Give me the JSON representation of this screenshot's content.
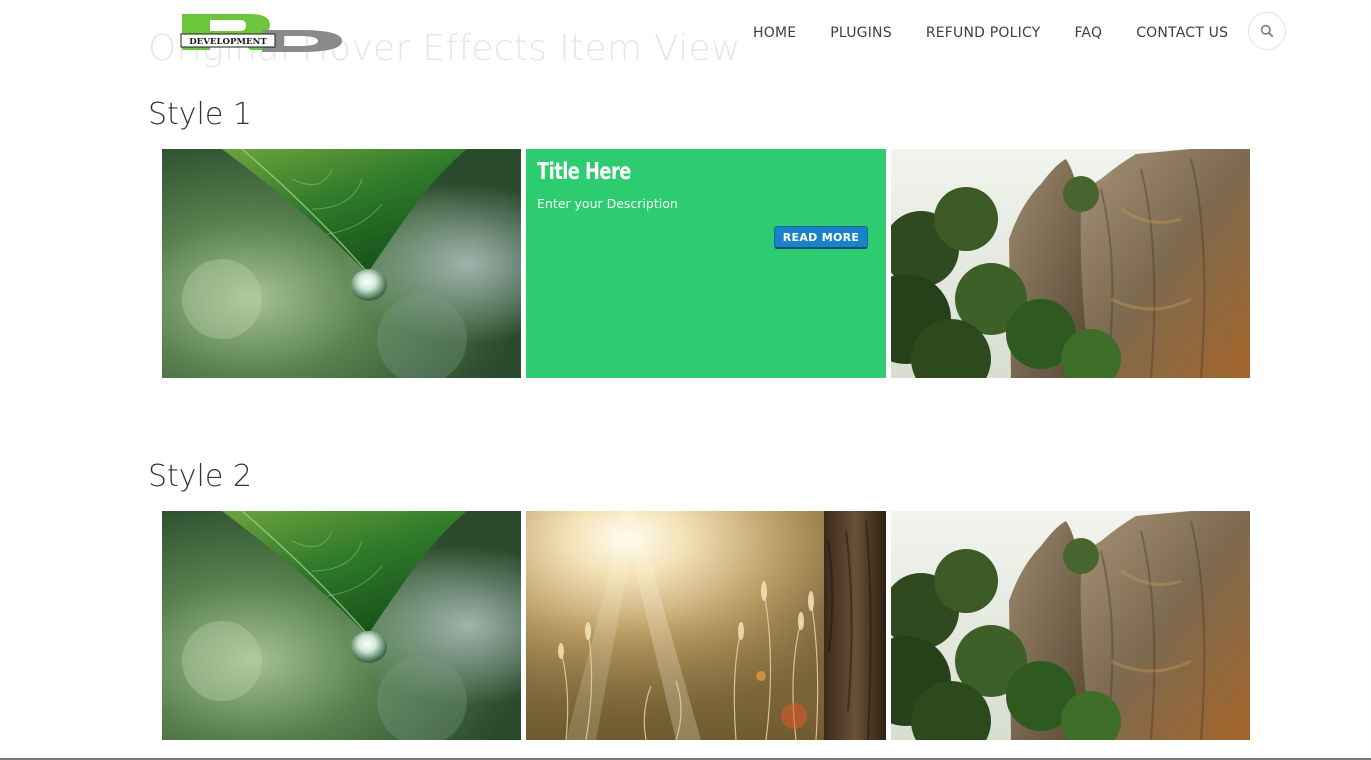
{
  "page": {
    "heading": "Original Hover Effects Item View"
  },
  "logo": {
    "big_letters": "RD",
    "banner_text": "DEVELOPMENT",
    "colors": {
      "green": "#6cc53a",
      "gray": "#8a8a8a"
    }
  },
  "nav": {
    "items": [
      {
        "label": "HOME"
      },
      {
        "label": "PLUGINS"
      },
      {
        "label": "REFUND POLICY"
      },
      {
        "label": "FAQ"
      },
      {
        "label": "CONTACT US"
      }
    ],
    "search_icon": "search-icon"
  },
  "style1": {
    "title": "Style 1",
    "hover": {
      "title": "Title Here",
      "description": "Enter your Description",
      "button": "READ MORE",
      "panel_color": "#2ecc71",
      "button_color": "#1a82c6"
    },
    "images": [
      "leaf-water-drop",
      "hover-panel",
      "sandstone-rocks"
    ]
  },
  "style2": {
    "title": "Style 2",
    "images": [
      "leaf-water-drop",
      "sunlit-meadow",
      "sandstone-rocks"
    ]
  }
}
